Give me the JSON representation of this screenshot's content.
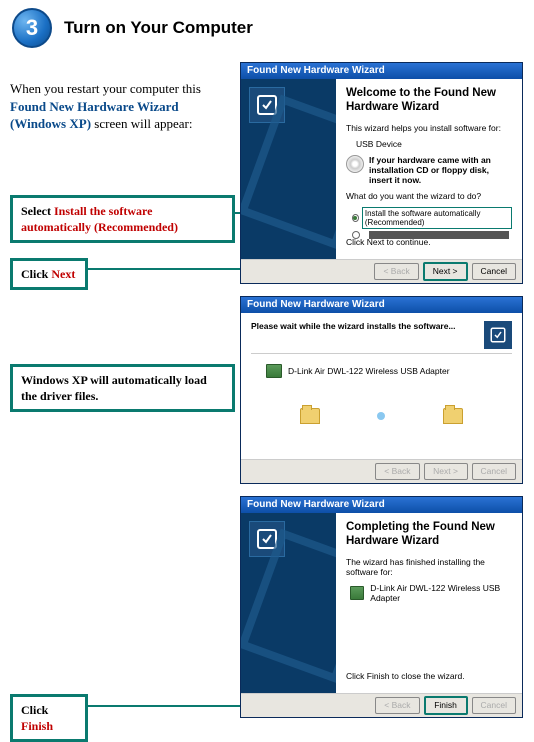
{
  "step": {
    "number": "3",
    "title": "Turn on Your Computer"
  },
  "intro": {
    "line1": "When you restart your computer this ",
    "highlight": "Found New Hardware Wizard (Windows XP)",
    "line2": " screen will appear:"
  },
  "callouts": {
    "c1_prefix": "Select ",
    "c1_red": "Install the software automatically (Recommended)",
    "c2_prefix": "Click ",
    "c2_red": "Next",
    "c3": "Windows XP will automatically load the driver files.",
    "c4_prefix": "Click ",
    "c4_red": "Finish"
  },
  "wiz1": {
    "titlebar": "Found New Hardware Wizard",
    "h1": "Welcome to the Found New Hardware Wizard",
    "p1": "This wizard helps you install software for:",
    "device": "USB Device",
    "cd_text": "If your hardware came with an installation CD or floppy disk, insert it now.",
    "q": "What do you want the wizard to do?",
    "opt1": "Install the software automatically (Recommended)",
    "note": "Click Next to continue.",
    "back": "< Back",
    "next": "Next >",
    "cancel": "Cancel"
  },
  "wiz2": {
    "titlebar": "Found New Hardware Wizard",
    "subhead": "Please wait while the wizard installs the software...",
    "device": "D-Link Air DWL-122 Wireless USB Adapter",
    "back": "< Back",
    "next": "Next >",
    "cancel": "Cancel"
  },
  "wiz3": {
    "titlebar": "Found New Hardware Wizard",
    "h1": "Completing the Found New Hardware Wizard",
    "p1": "The wizard has finished installing the software for:",
    "device": "D-Link Air DWL-122 Wireless USB Adapter",
    "note": "Click Finish to close the wizard.",
    "back": "< Back",
    "finish": "Finish",
    "cancel": "Cancel"
  }
}
